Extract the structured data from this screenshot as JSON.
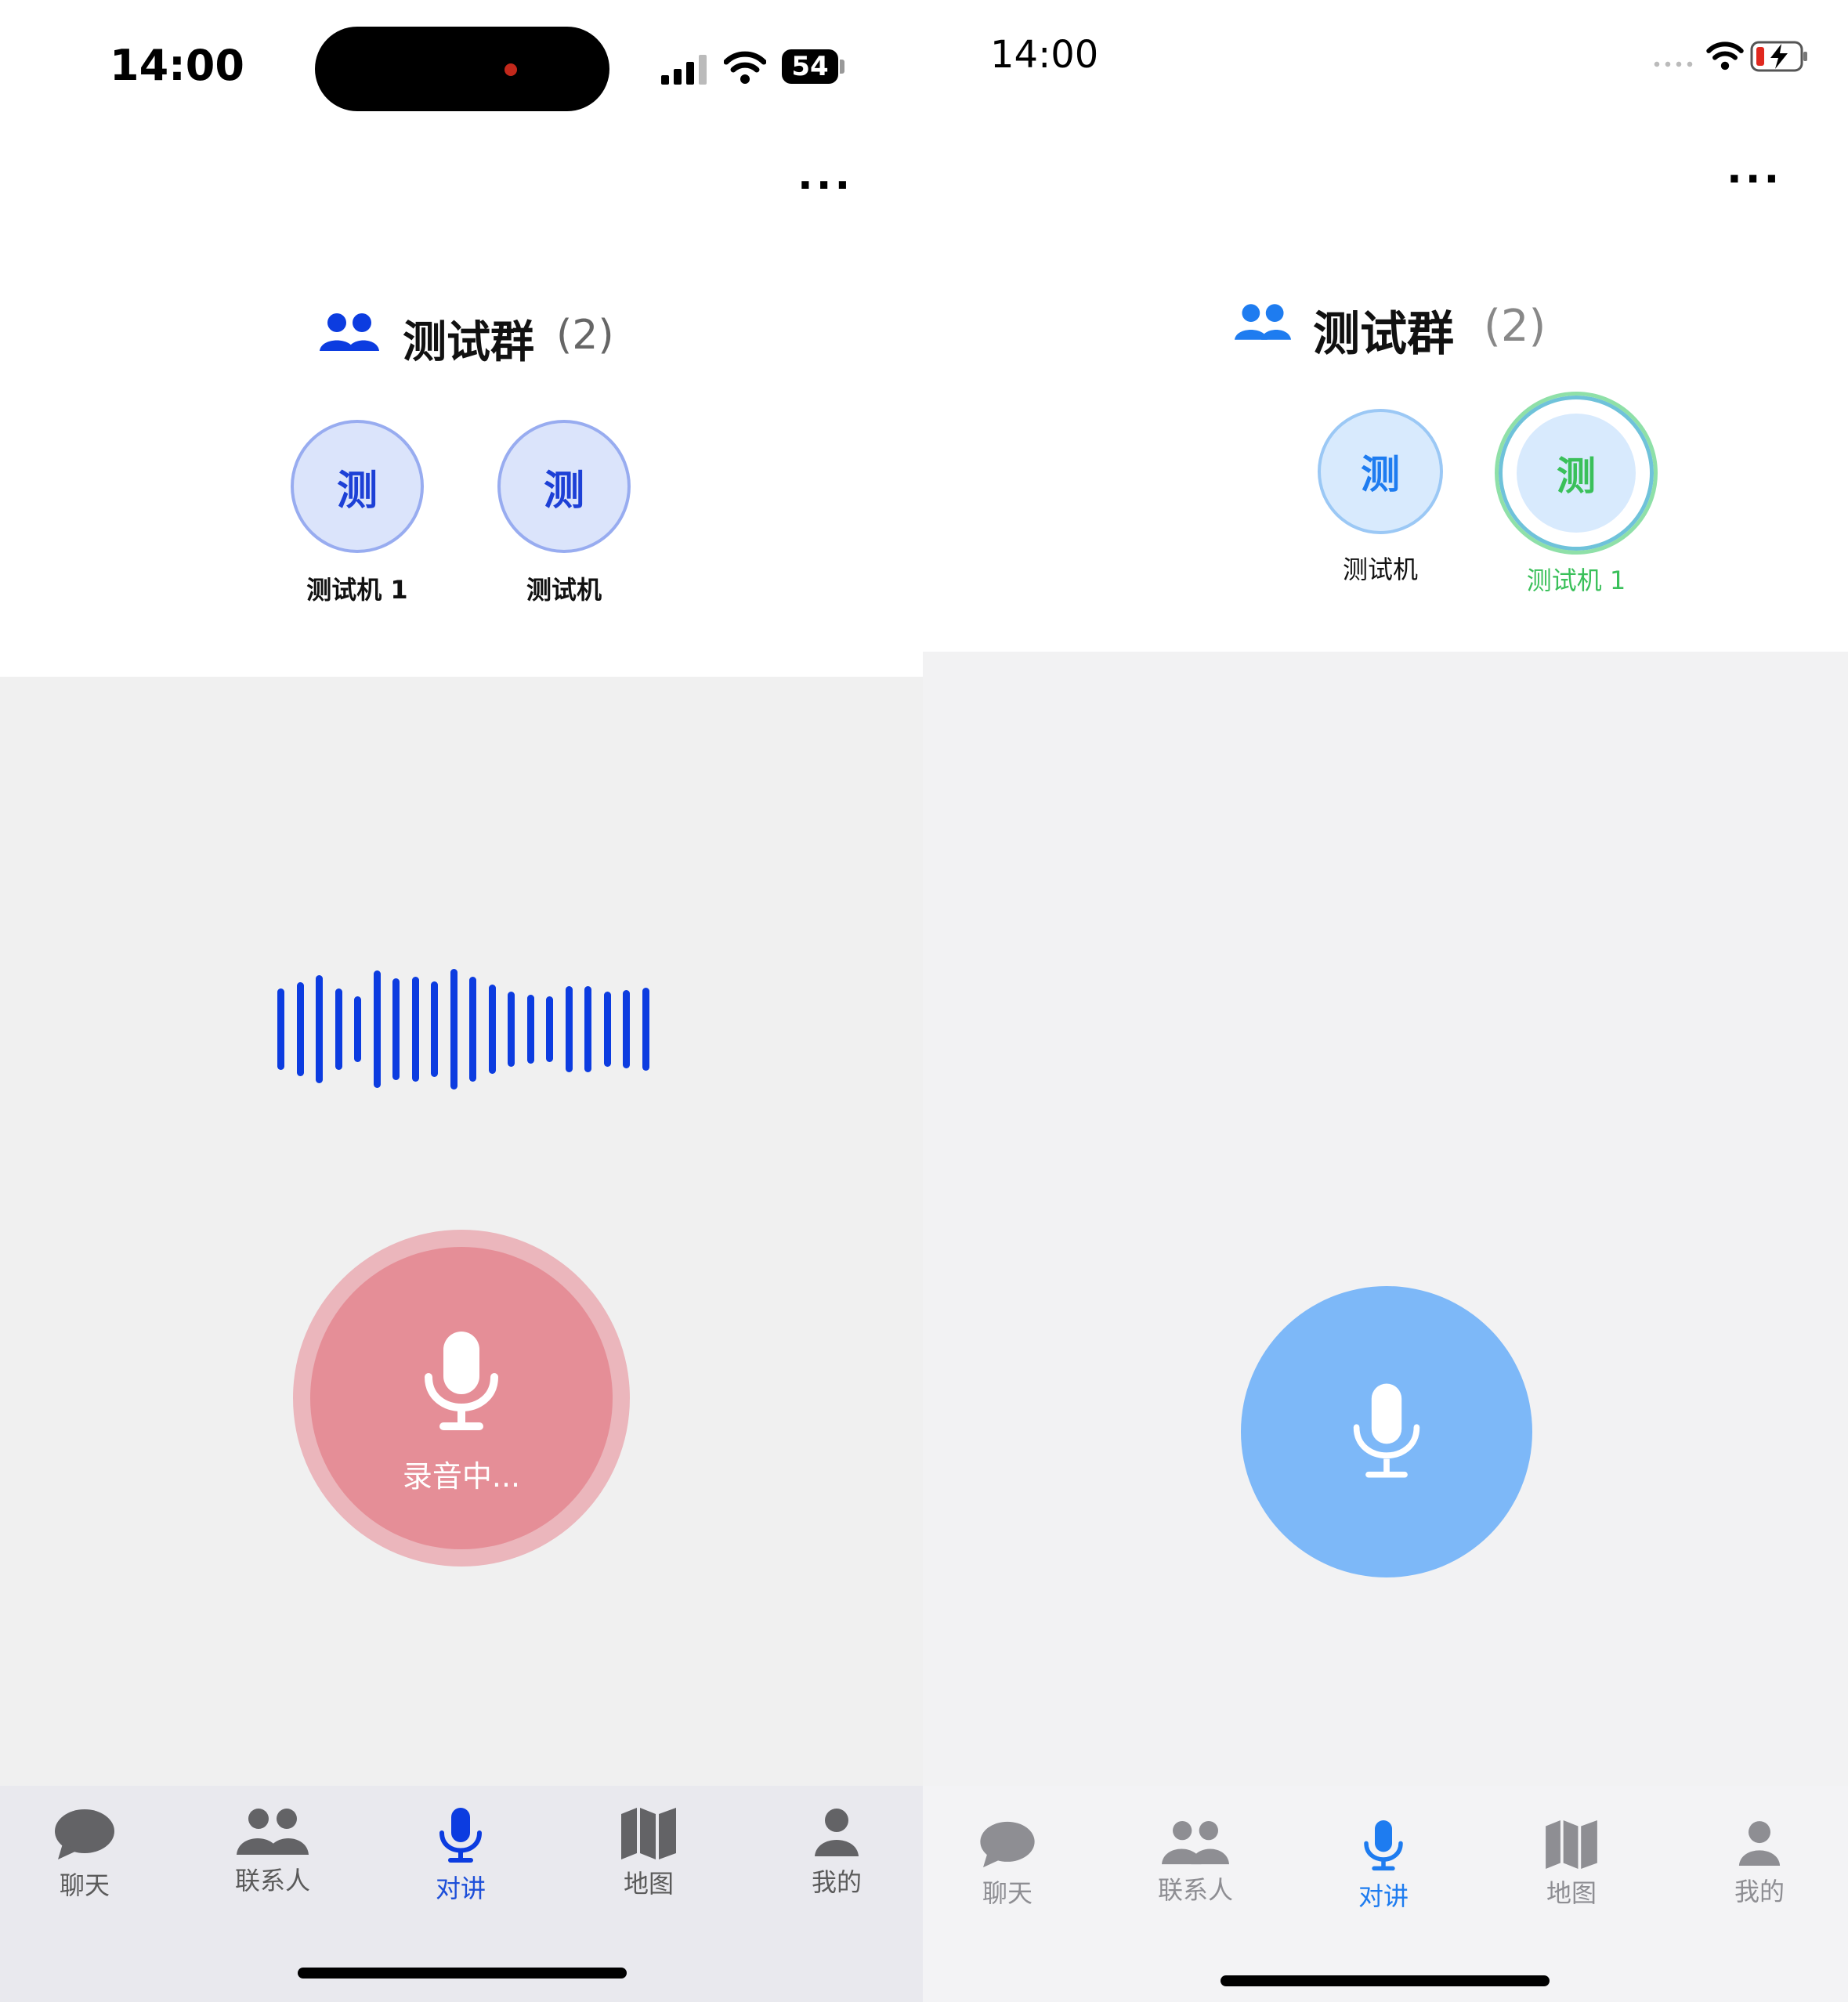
{
  "left": {
    "status": {
      "time": "14:00",
      "battery": "54"
    },
    "more": "...",
    "group": {
      "name": "测试群",
      "count": "(2)"
    },
    "members": [
      {
        "avatar": "测",
        "name": "测试机 1"
      },
      {
        "avatar": "测",
        "name": "测试机"
      }
    ],
    "record_label": "录音中...",
    "tabs": [
      {
        "label": "聊天"
      },
      {
        "label": "联系人"
      },
      {
        "label": "对讲"
      },
      {
        "label": "地图"
      },
      {
        "label": "我的"
      }
    ],
    "active_tab": "对讲"
  },
  "right": {
    "status": {
      "time": "14:00"
    },
    "more": "...",
    "group": {
      "name": "测试群",
      "count": "(2)"
    },
    "members": [
      {
        "avatar": "测",
        "name": "测试机"
      },
      {
        "avatar": "测",
        "name": "测试机 1"
      }
    ],
    "tabs": [
      {
        "label": "聊天"
      },
      {
        "label": "联系人"
      },
      {
        "label": "对讲"
      },
      {
        "label": "地图"
      },
      {
        "label": "我的"
      }
    ],
    "active_tab": "对讲"
  },
  "icons": {
    "group": "group-people-icon",
    "mic": "microphone-icon",
    "chat": "chat-bubble-icon",
    "contacts": "contacts-icon",
    "map": "map-icon",
    "profile": "person-icon"
  },
  "colors": {
    "blue_dark": "#0c3ce0",
    "blue_light": "#1e7cf0",
    "recording_red": "#e58e97",
    "talk_button_blue": "#7db8f8",
    "speaking_green": "#3ac05a"
  }
}
